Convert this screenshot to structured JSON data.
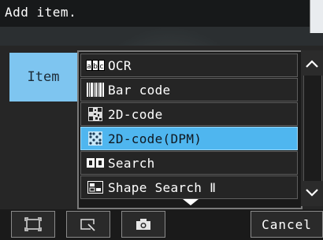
{
  "prompt": "Add item.",
  "tab_label": "Item",
  "items": [
    {
      "label": "OCR",
      "icon": "ocr-icon",
      "selected": false
    },
    {
      "label": "Bar code",
      "icon": "barcode-icon",
      "selected": false
    },
    {
      "label": "2D-code",
      "icon": "2d-code-icon",
      "selected": false
    },
    {
      "label": "2D-code(DPM)",
      "icon": "2d-code-dpm-icon",
      "selected": true
    },
    {
      "label": "Search",
      "icon": "search-icon",
      "selected": false
    },
    {
      "label": "Shape Search Ⅱ",
      "icon": "shape-search-icon",
      "selected": false
    }
  ],
  "toolbar": {
    "cancel_label": "Cancel"
  },
  "colors": {
    "accent": "#4fb6ef",
    "tab": "#7ec5f0"
  }
}
